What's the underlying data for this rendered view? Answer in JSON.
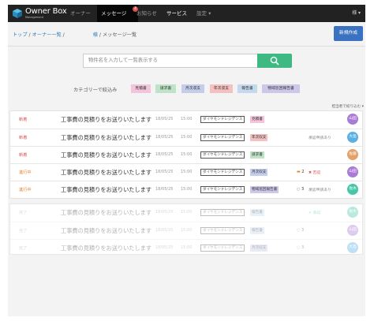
{
  "nav": {
    "brand": "Owner Box",
    "brand_sub": "Management",
    "items": [
      "オーナー",
      "メッセージ",
      "お知らせ",
      "サービス",
      "設定 ▾"
    ],
    "badge": "4",
    "user": "様 ▾"
  },
  "breadcrumb": {
    "top": "トップ",
    "owners": "オーナー一覧",
    "sep1": " / ",
    "sep2": " / ",
    "name_suffix": "様",
    "current": " / メッセージ一覧"
  },
  "new_button": "新規作成",
  "search": {
    "placeholder": "物件名を入力して一覧表示する"
  },
  "category": {
    "label": "カテゴリーで絞込み",
    "tags": [
      "見積書",
      "請求書",
      "月次収支",
      "年次収支",
      "報告書",
      "物域巡回報告書"
    ]
  },
  "sort_label": "担当者で絞り込む ▾",
  "rows": [
    {
      "status": "新着",
      "subject": "工事費の見積りをお送りいたします",
      "date": "18/05/25",
      "time": "15:00",
      "property": "ダイヤモンドレジデンス",
      "tag": "見積書",
      "comment": "",
      "sign": "",
      "avatar": "山田"
    },
    {
      "status": "新着",
      "subject": "工事費の見積りをお送りいたします",
      "date": "18/05/25",
      "time": "15:00",
      "property": "ダイヤモンドレジデンス",
      "tag": "年次収支",
      "comment": "",
      "sign": "承認申請あり",
      "avatar": "大島"
    },
    {
      "status": "新着",
      "subject": "工事費の見積りをお送りいたします",
      "date": "18/05/25",
      "time": "15:00",
      "property": "ダイヤモンドレジデンス",
      "tag": "請求書",
      "comment": "",
      "sign": "",
      "avatar": "佐藤"
    },
    {
      "status": "進行中",
      "subject": "工事費の見積りをお送りいたします",
      "date": "18/05/25",
      "time": "15:00",
      "property": "ダイヤモンドレジデンス",
      "tag": "月次収支",
      "comment": "2",
      "sign": "否認",
      "avatar": "山田"
    },
    {
      "status": "進行中",
      "subject": "工事費の見積りをお送りいたします",
      "date": "18/05/25",
      "time": "15:00",
      "property": "ダイヤモンドレジデンス",
      "tag": "物域巡回報告書",
      "comment": "3",
      "sign": "承認申請あり",
      "avatar": "佐木"
    },
    {
      "status": "完了",
      "subject": "工事費の見積りをお送りいたします",
      "date": "18/05/25",
      "time": "15:00",
      "property": "ダイヤモンドレジデンス",
      "tag": "報告書",
      "comment": "",
      "sign": "承認",
      "avatar": "佐木"
    },
    {
      "status": "完了",
      "subject": "工事費の見積りをお送りいたします",
      "date": "18/05/25",
      "time": "15:00",
      "property": "ダイヤモンドレジデンス",
      "tag": "報告書",
      "comment": "3",
      "sign": "",
      "avatar": "山田"
    },
    {
      "status": "完了",
      "subject": "工事費の見積りをお送りいたします",
      "date": "18/05/25",
      "time": "15:00",
      "property": "ダイヤモンドレジデンス",
      "tag": "月次収支",
      "comment": "3",
      "sign": "",
      "avatar": "大島"
    }
  ],
  "colors": {
    "nav_bg": "#222222",
    "primary": "#3a71c1",
    "search_green": "#3fb982",
    "status_new": "#d9534f",
    "status_progress": "#e67e22",
    "status_done": "#999999",
    "tag_見積書": "#f3c4dc",
    "tag_請求書": "#bfe3c8",
    "tag_月次収支": "#c4cde9",
    "tag_年次収支": "#f5c0c0",
    "tag_報告書": "#c5d9ee",
    "tag_物域巡回報告書": "#cdc8ea",
    "avatar_山田": "#a97bd6",
    "avatar_大島": "#5ab0e3",
    "avatar_佐藤": "#e2a26a",
    "avatar_佐木": "#48c7a8"
  }
}
